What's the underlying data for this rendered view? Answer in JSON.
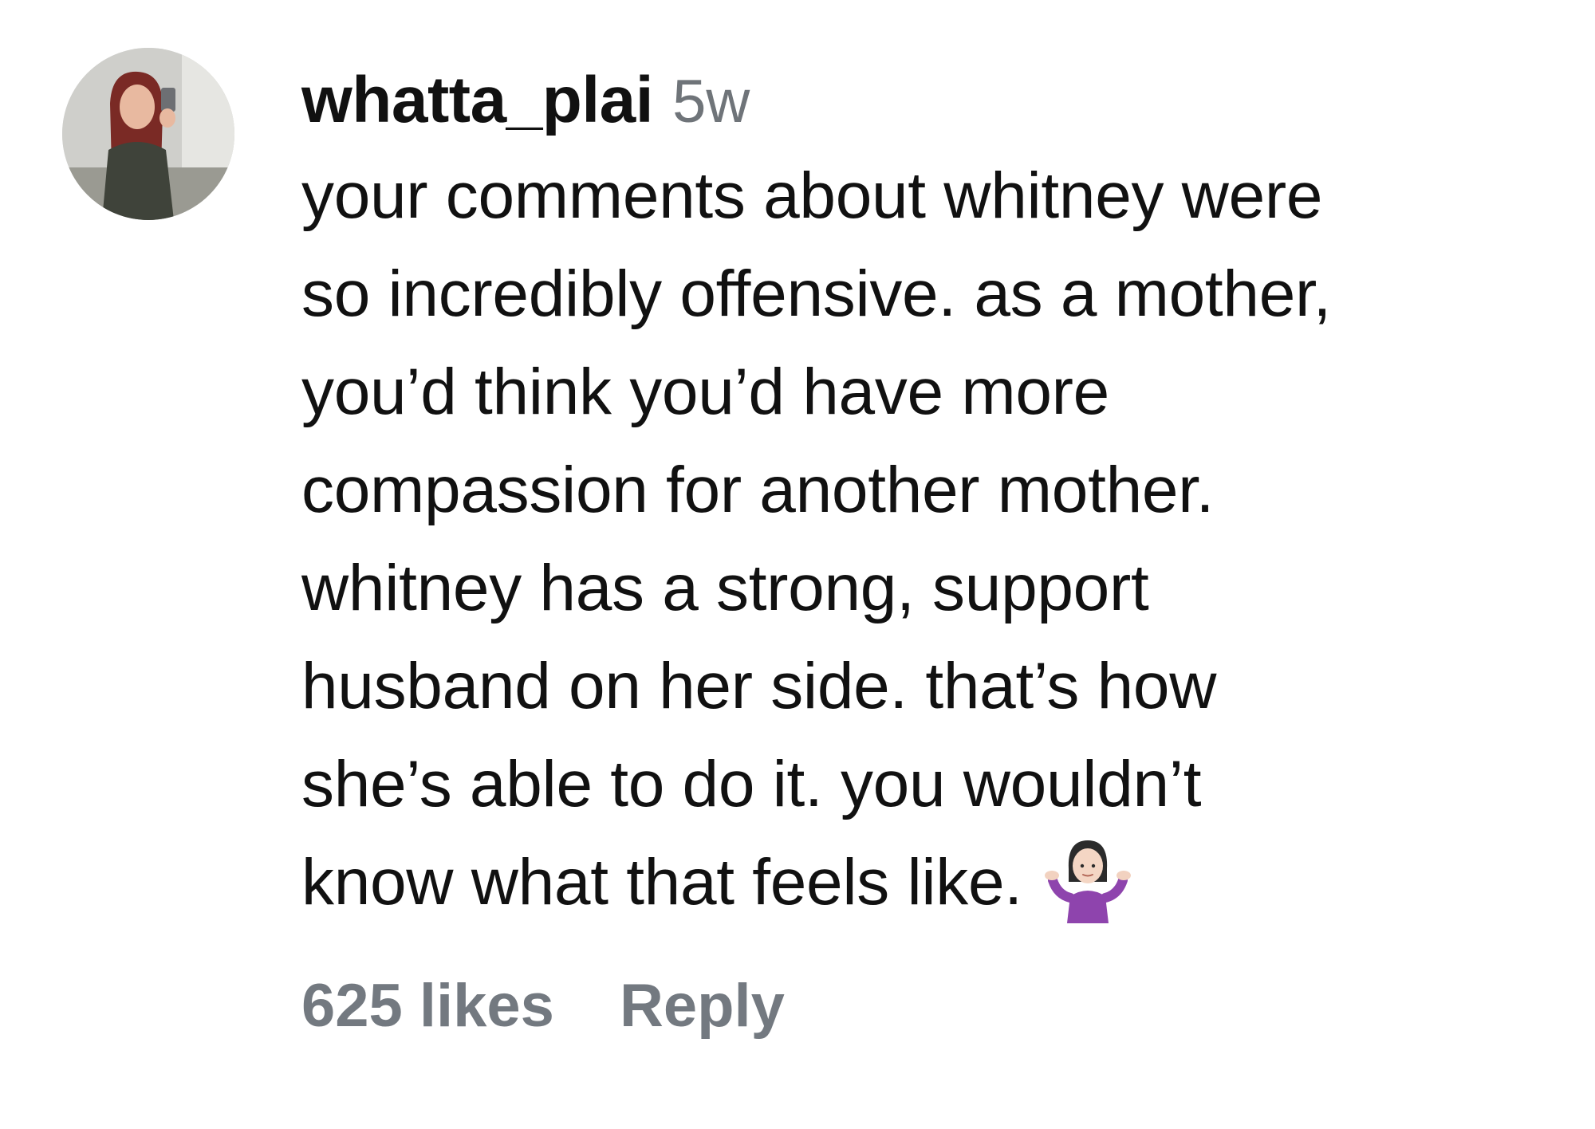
{
  "comment": {
    "username": "whatta_plai",
    "timestamp": "5w",
    "text_lines": [
      "your comments about whitney were",
      "so incredibly offensive. as a mother,",
      "you’d think you’d have more",
      "compassion for another mother.",
      "whitney has a strong, support",
      "husband on her side. that’s how",
      "she’s able to do it. you wouldn’t",
      "know what that feels like."
    ],
    "trailing_emoji": "woman-shrugging-emoji",
    "likes_label": "625 likes",
    "reply_label": "Reply"
  },
  "colors": {
    "text": "#111111",
    "muted": "#6f7479",
    "action": "#737980",
    "emoji_shirt": "#8e44ad"
  }
}
